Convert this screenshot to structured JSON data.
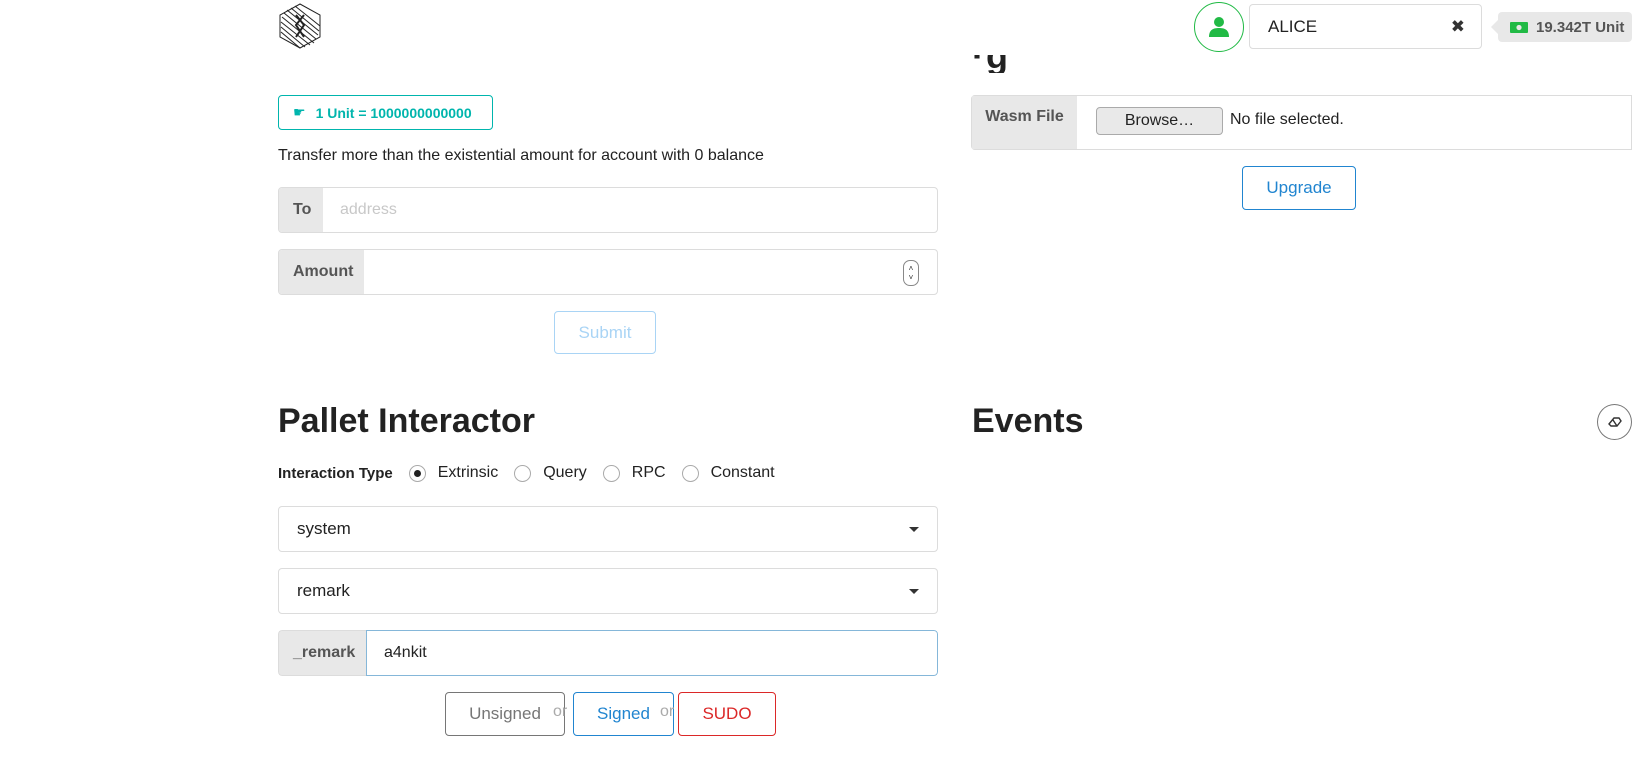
{
  "header": {
    "account_name": "ALICE",
    "balance": "19.342T Unit",
    "clear_icon": "close-icon",
    "avatar_icon": "user-icon",
    "balance_icon": "money-icon"
  },
  "transfer": {
    "unit_label": "1 Unit = 1000000000000",
    "hint": "Transfer more than the existential amount for account with 0 balance",
    "to_label": "To",
    "to_placeholder": "address",
    "to_value": "",
    "amount_label": "Amount",
    "amount_value": "",
    "submit_label": "Submit"
  },
  "upgrade": {
    "wasm_label": "Wasm File",
    "browse_label": "Browse…",
    "file_status": "No file selected.",
    "upgrade_label": "Upgrade"
  },
  "pallet": {
    "title": "Pallet Interactor",
    "interaction_label": "Interaction Type",
    "types": [
      {
        "label": "Extrinsic",
        "selected": true
      },
      {
        "label": "Query",
        "selected": false
      },
      {
        "label": "RPC",
        "selected": false
      },
      {
        "label": "Constant",
        "selected": false
      }
    ],
    "pallet_value": "system",
    "call_value": "remark",
    "param_label": "_remark",
    "param_value": "a4nkit",
    "or_text": "or",
    "buttons": {
      "unsigned": "Unsigned",
      "signed": "Signed",
      "sudo": "SUDO"
    }
  },
  "events": {
    "title": "Events"
  },
  "colors": {
    "teal": "#00b5ad",
    "blue": "#2185d0",
    "red": "#db2828",
    "green": "#21ba45"
  }
}
